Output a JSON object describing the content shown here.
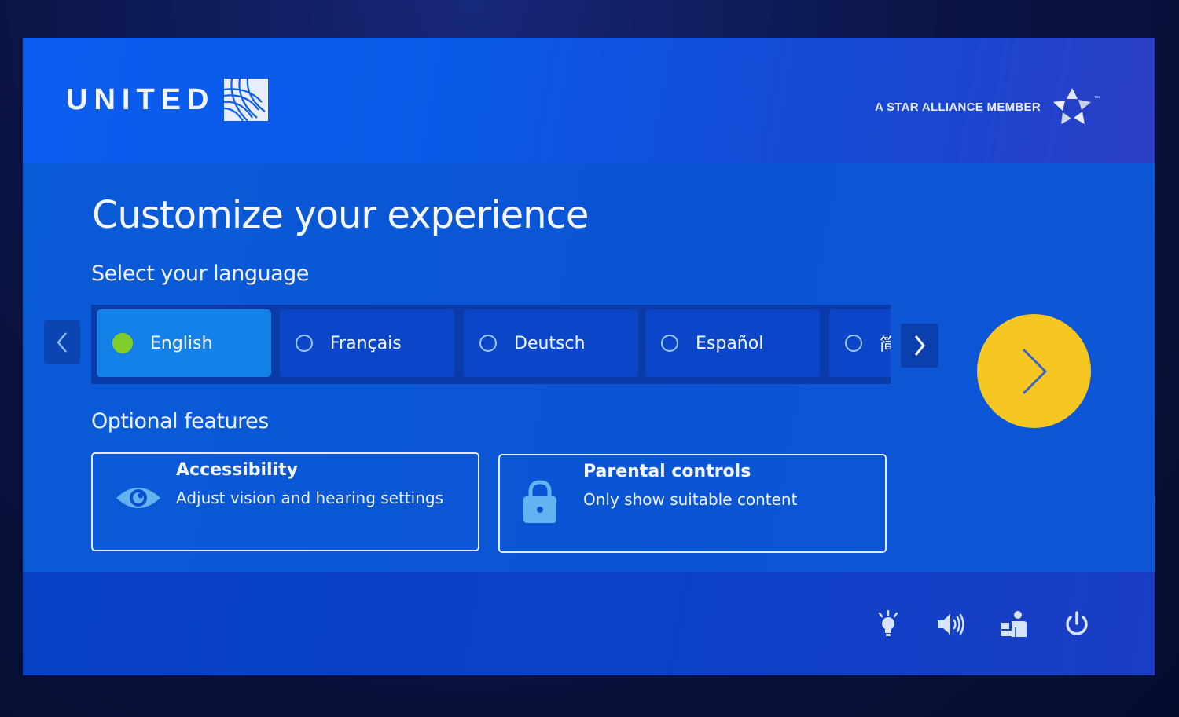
{
  "header": {
    "brand": "UNITED",
    "alliance_text": "A STAR ALLIANCE MEMBER",
    "alliance_tm": "™"
  },
  "main": {
    "title": "Customize your experience",
    "language_heading": "Select your language",
    "languages": [
      {
        "label": "English",
        "selected": true
      },
      {
        "label": "Français",
        "selected": false
      },
      {
        "label": "Deutsch",
        "selected": false
      },
      {
        "label": "Español",
        "selected": false
      },
      {
        "label": "简",
        "selected": false
      }
    ],
    "optional_heading": "Optional features",
    "features": [
      {
        "title": "Accessibility",
        "description": "Adjust vision and hearing settings",
        "icon": "eye-icon"
      },
      {
        "title": "Parental controls",
        "description": "Only show suitable content",
        "icon": "lock-icon"
      }
    ]
  },
  "footer": {
    "icons": [
      "light-icon",
      "volume-icon",
      "attendant-call-icon",
      "power-icon"
    ]
  },
  "colors": {
    "accent_yellow": "#f6c623",
    "selected_language": "#1481e8",
    "selected_radio": "#7fcc2a"
  }
}
